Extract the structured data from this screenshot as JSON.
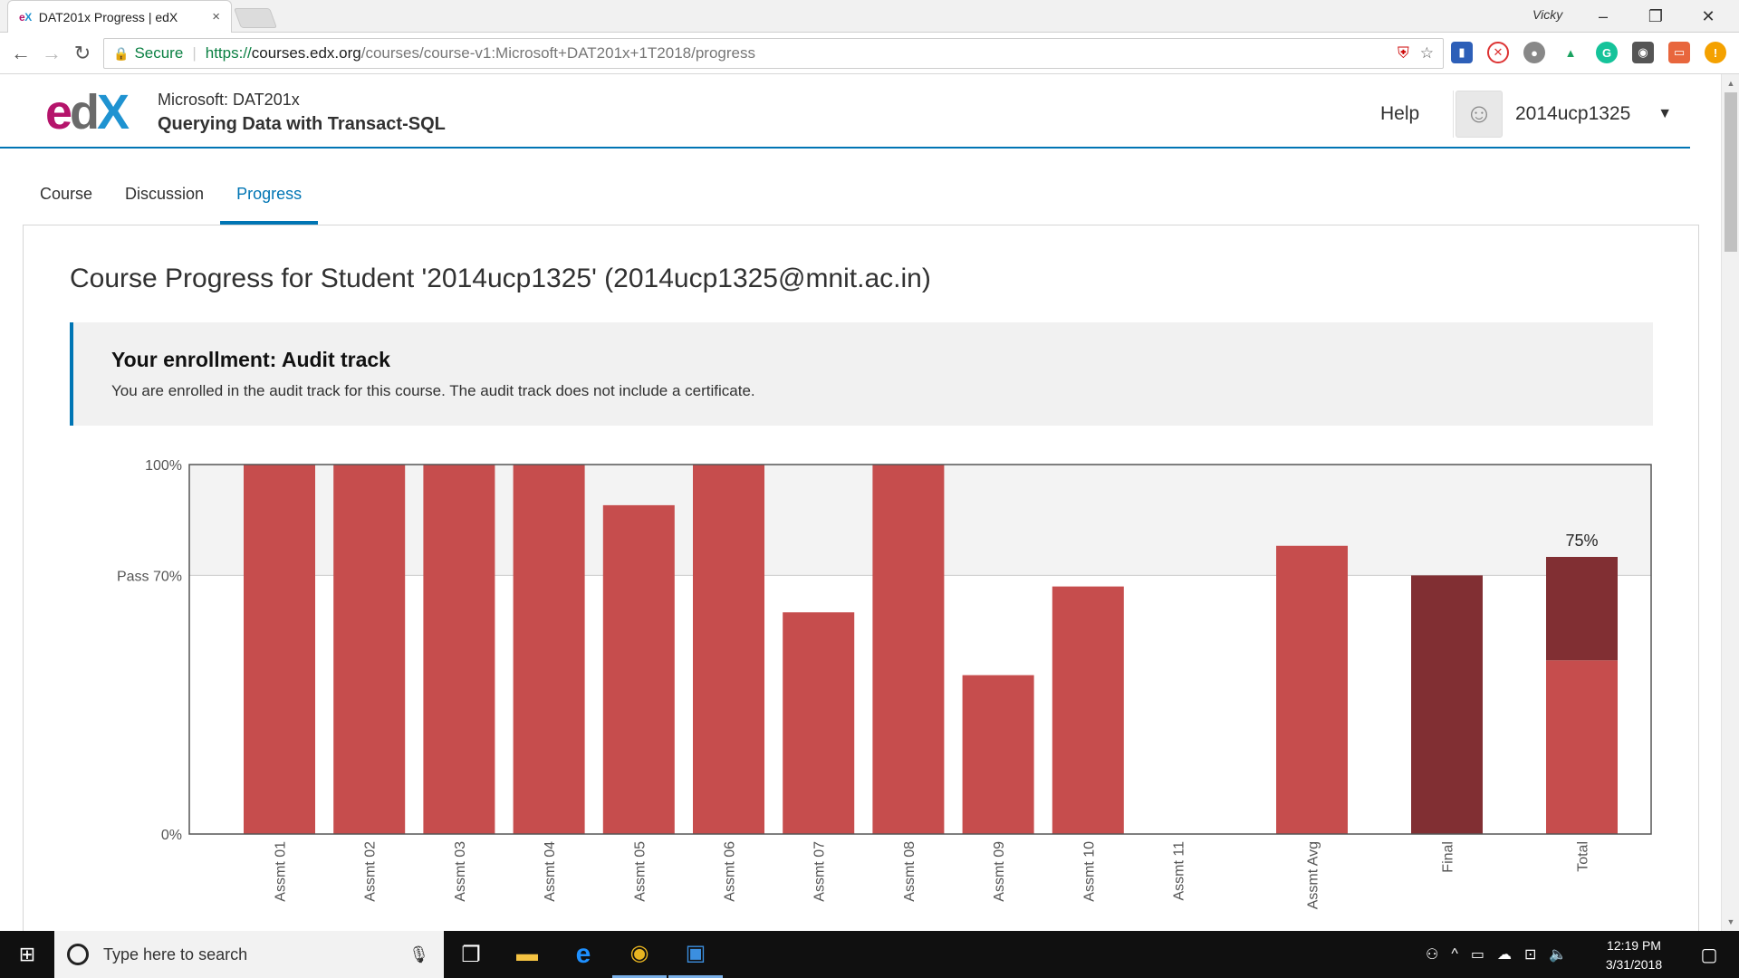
{
  "browser": {
    "tab_title": "DAT201x Progress | edX",
    "tab_close": "×",
    "profile_name": "Vicky",
    "secure_label": "Secure",
    "url_proto": "https://",
    "url_host": "courses.edx.org",
    "url_path": "/courses/course-v1:Microsoft+DAT201x+1T2018/progress"
  },
  "header": {
    "logo_e": "e",
    "logo_d": "d",
    "logo_x": "X",
    "course_org": "Microsoft: DAT201x",
    "course_name": "Querying Data with Transact-SQL",
    "help": "Help",
    "username": "2014ucp1325"
  },
  "tabs": [
    {
      "label": "Course"
    },
    {
      "label": "Discussion"
    },
    {
      "label": "Progress"
    }
  ],
  "main": {
    "page_title": "Course Progress for Student '2014ucp1325' (2014ucp1325@mnit.ac.in)",
    "enrollment_title": "Your enrollment: Audit track",
    "enrollment_desc": "You are enrolled in the audit track for this course. The audit track does not include a certificate."
  },
  "chart_data": {
    "type": "bar",
    "categories": [
      "Assmt 01",
      "Assmt 02",
      "Assmt 03",
      "Assmt 04",
      "Assmt 05",
      "Assmt 06",
      "Assmt 07",
      "Assmt 08",
      "Assmt 09",
      "Assmt 10",
      "Assmt 11",
      "Assmt Avg",
      "Final",
      "Total"
    ],
    "values": [
      100,
      100,
      100,
      100,
      89,
      100,
      60,
      100,
      43,
      67,
      0,
      78,
      70,
      75
    ],
    "total_breakdown": {
      "assessments": 47,
      "final": 28
    },
    "total_label": "75%",
    "y_ticks": [
      {
        "value": 0,
        "label": "0%"
      },
      {
        "value": 70,
        "label": "Pass 70%"
      },
      {
        "value": 100,
        "label": "100%"
      }
    ],
    "ylim": [
      0,
      100
    ],
    "colors": {
      "bar": "#c64d4d",
      "bar_dark": "#812f33",
      "pass_band": "#f3f3f3",
      "grid": "#cccccc"
    }
  },
  "taskbar": {
    "search_placeholder": "Type here to search",
    "time": "12:19 PM",
    "date": "3/31/2018"
  }
}
